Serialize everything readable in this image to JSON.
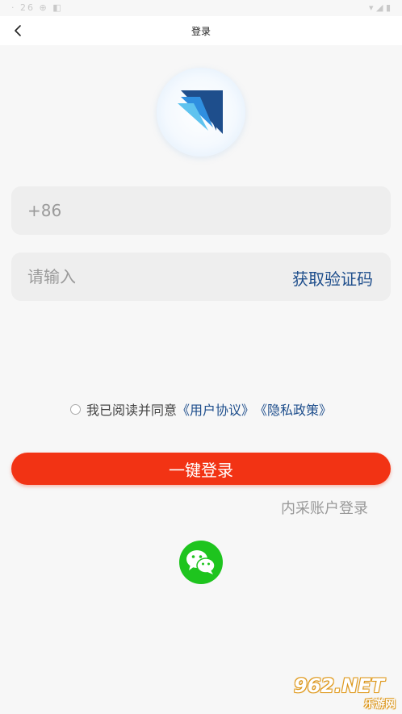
{
  "status_bar": {
    "left": "· 26  ⊕  ◧",
    "right": "▾ ◢ ▮"
  },
  "nav": {
    "title": "登录",
    "back_icon": "chevron-left-icon"
  },
  "logo": {
    "icon": "app-logo-icon",
    "colors": [
      "#1e4e8c",
      "#2f8fe0",
      "#5fc3ef"
    ]
  },
  "phone_field": {
    "placeholder": "+86",
    "value": ""
  },
  "code_field": {
    "placeholder": "请输入",
    "value": "",
    "button_label": "获取验证码"
  },
  "agreement": {
    "text": "我已阅读并同意",
    "user_agreement": "《用户协议》",
    "privacy_policy": "《隐私政策》"
  },
  "login_button": {
    "label": "一键登录",
    "color": "#f23314"
  },
  "internal_login": {
    "label": "内采账户登录"
  },
  "wechat": {
    "icon": "wechat-icon",
    "color": "#1ec41e"
  },
  "watermark": {
    "main": "962.NET",
    "sub": "乐游网"
  }
}
